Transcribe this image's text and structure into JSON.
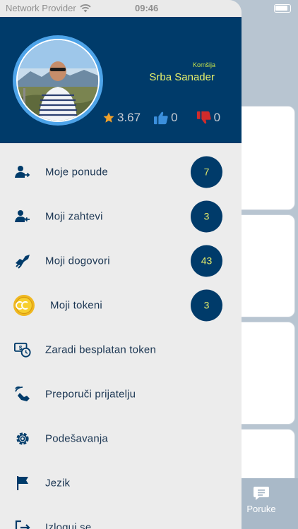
{
  "status_bar": {
    "carrier": "Network Provider",
    "time": "09:46"
  },
  "profile": {
    "role": "Komšija",
    "name": "Srba Sanader",
    "rating": "3.67",
    "likes": "0",
    "dislikes": "0"
  },
  "menu": [
    {
      "label": "Moje ponude",
      "badge": "7",
      "icon": "user-arrow-right-icon"
    },
    {
      "label": "Moji zahtevi",
      "badge": "3",
      "icon": "user-arrow-left-icon"
    },
    {
      "label": "Moji dogovori",
      "badge": "43",
      "icon": "handshake-icon"
    },
    {
      "label": "Moji tokeni",
      "badge": "3",
      "icon": "token-coin-icon"
    },
    {
      "label": "Zaradi besplatan token",
      "icon": "money-clock-icon"
    },
    {
      "label": "Preporuči prijatelju",
      "icon": "share-hand-icon"
    },
    {
      "label": "Podešavanja",
      "icon": "gear-icon"
    },
    {
      "label": "Jezik",
      "icon": "flag-icon"
    },
    {
      "label": "Izloguj se",
      "icon": "logout-icon"
    }
  ],
  "background_app": {
    "tab_label": "Poruke",
    "tab_icon": "message-icon"
  },
  "colors": {
    "primary": "#003b6a",
    "accent": "#e7f06a",
    "star": "#f0a12b",
    "like": "#3b8fdc",
    "dislike": "#d12b2b"
  }
}
